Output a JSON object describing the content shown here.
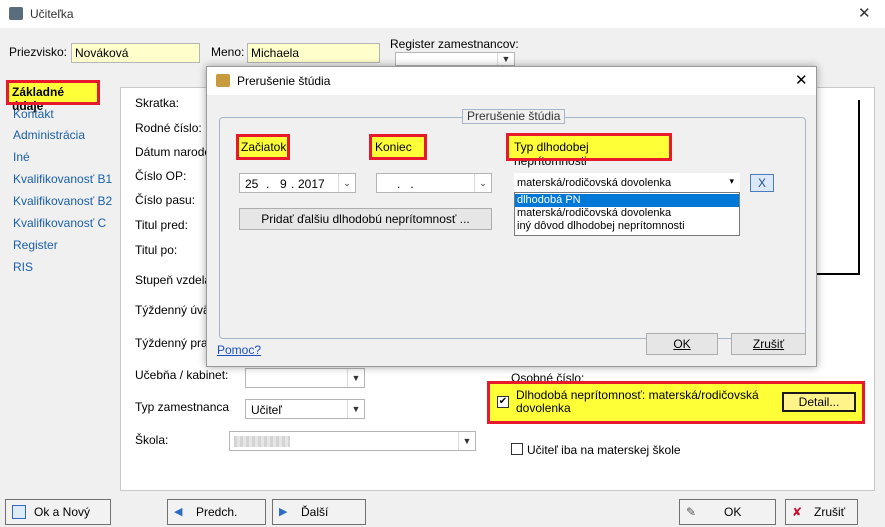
{
  "window": {
    "title": "Učiteľka",
    "close": "✕"
  },
  "header": {
    "surname_label": "Priezvisko:",
    "surname_value": "Nováková",
    "name_label": "Meno:",
    "name_value": "Michaela",
    "register_label": "Register zamestnancov:"
  },
  "sidebar": {
    "items": [
      {
        "label": "Základné údaje"
      },
      {
        "label": "Kontakt"
      },
      {
        "label": "Administrácia"
      },
      {
        "label": "Iné"
      },
      {
        "label": "Kvalifikovanosť B1"
      },
      {
        "label": "Kvalifikovanosť B2"
      },
      {
        "label": "Kvalifikovanosť C"
      },
      {
        "label": "Register"
      },
      {
        "label": "RIS"
      }
    ]
  },
  "form": {
    "labels": {
      "skratka": "Skratka:",
      "rodne_cislo": "Rodné číslo:",
      "datum_narodenia": "Dátum narode",
      "cislo_op": "Číslo OP:",
      "cislo_pasu": "Číslo pasu:",
      "titul_pred": "Titul pred:",
      "titul_po": "Titul po:",
      "stupen": "Stupeň vzdela",
      "tyzdenny_uv": "Týždenný úvä",
      "tyzdenny_prac": "Týždenný prac",
      "ucebna": "Učebňa / kabinet:",
      "typ_zam": "Typ zamestnanca",
      "skola": "Škola:",
      "osobne_cislo": "Osobné číslo:"
    },
    "typ_zam_value": "Učiteľ",
    "dlhodoba_checkbox_label": "Dlhodobá neprítomnosť: materská/rodičovská dovolenka",
    "detail_button": "Detail...",
    "materska_checkbox_label": "Učiteľ iba na materskej škole"
  },
  "bottom": {
    "ok_new": "Ok a Nový",
    "prev": "Predch.",
    "next": "Ďalší",
    "ok": "OK",
    "cancel": "Zrušiť"
  },
  "dialog": {
    "title": "Prerušenie štúdia",
    "group_title": "Prerušenie štúdia",
    "start_label": "Začiatok",
    "end_label": "Koniec",
    "type_label": "Typ dlhodobej neprítomnosti",
    "start_day": "25",
    "start_month": "9",
    "start_year": "2017",
    "end_placeholder": ".   .",
    "type_selected": "materská/rodičovská dovolenka",
    "type_options": [
      "dlhodobá PN",
      "materská/rodičovská dovolenka",
      "iný dôvod dlhodobej neprítomnosti"
    ],
    "add_button": "Pridať ďalšiu dlhodobú neprítomnosť ...",
    "remove_button": "X",
    "help_link": "Pomoc?",
    "ok_button": "OK",
    "cancel_button": "Zrušiť"
  },
  "colors": {
    "highlight_fill": "#ffff38",
    "highlight_border": "#e8192c",
    "link": "#1a5fa8"
  }
}
